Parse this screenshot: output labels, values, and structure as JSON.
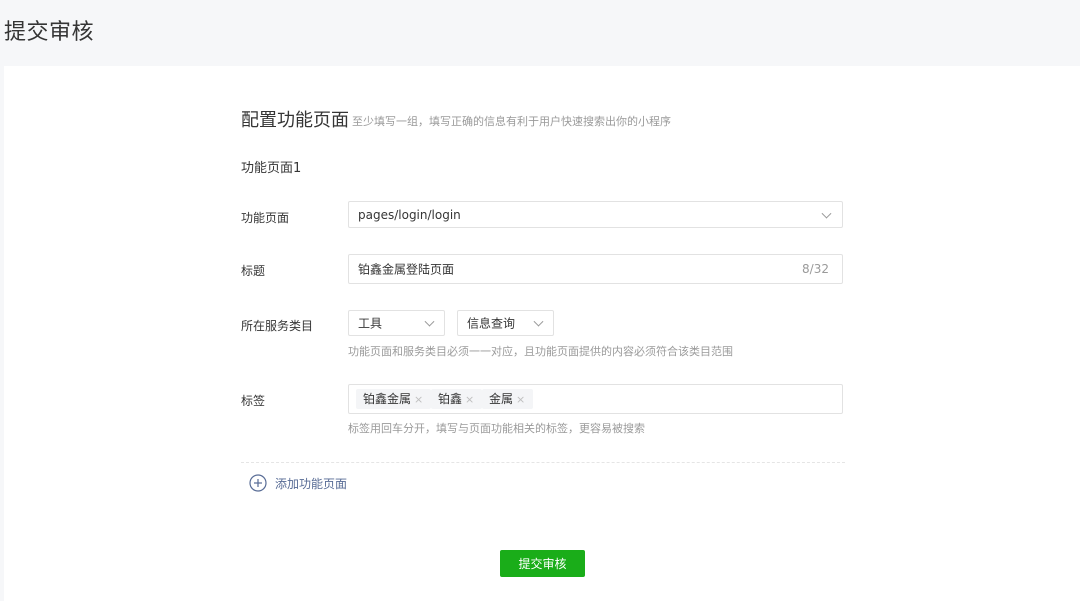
{
  "page": {
    "title": "提交审核"
  },
  "section": {
    "title": "配置功能页面",
    "hint": "至少填写一组，填写正确的信息有利于用户快速搜索出你的小程序"
  },
  "group": {
    "title": "功能页面1"
  },
  "fields": {
    "page_label": "功能页面",
    "page_value": "pages/login/login",
    "title_label": "标题",
    "title_value": "铂鑫金属登陆页面",
    "title_counter": "8/32",
    "category_label": "所在服务类目",
    "category_primary": "工具",
    "category_secondary": "信息查询",
    "category_help": "功能页面和服务类目必须一一对应，且功能页面提供的内容必须符合该类目范围",
    "tags_label": "标签",
    "tags": [
      "铂鑫金属",
      "铂鑫",
      "金属"
    ],
    "tags_help": "标签用回车分开，填写与页面功能相关的标签，更容易被搜索"
  },
  "actions": {
    "add_page": "添加功能页面",
    "submit": "提交审核"
  },
  "colors": {
    "background": "#f6f7f9",
    "card": "#ffffff",
    "primary_button": "#1aad19",
    "link": "#576b95",
    "hint_text": "#9a9a9a"
  },
  "icons": {
    "add": "plus-circle-icon",
    "dropdown": "chevron-down-icon",
    "tag_remove": "close-icon"
  }
}
